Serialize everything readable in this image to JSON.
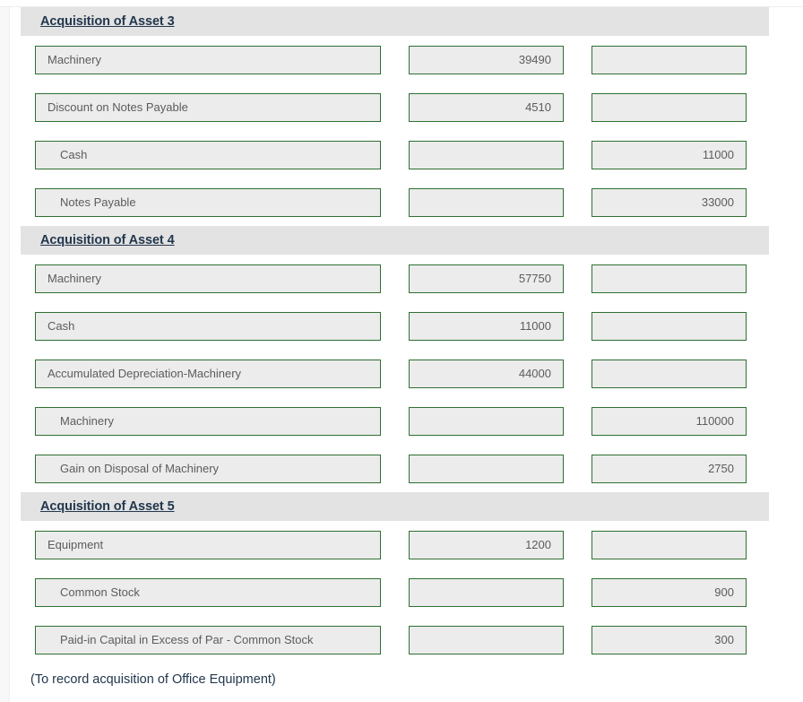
{
  "colors": {
    "field_border": "#2e7031",
    "field_background": "#ececec",
    "header_band": "#e3e3e3",
    "header_text": "#22374e",
    "field_text": "#5c5c5c"
  },
  "sections": [
    {
      "title": "Acquisition of Asset 3",
      "rows": [
        {
          "account": "Machinery",
          "debit": "39490",
          "credit": "",
          "type": "debit"
        },
        {
          "account": "Discount on Notes Payable",
          "debit": "4510",
          "credit": "",
          "type": "debit"
        },
        {
          "account": "Cash",
          "debit": "",
          "credit": "11000",
          "type": "credit"
        },
        {
          "account": "Notes Payable",
          "debit": "",
          "credit": "33000",
          "type": "credit"
        }
      ]
    },
    {
      "title": "Acquisition of Asset 4",
      "rows": [
        {
          "account": "Machinery",
          "debit": "57750",
          "credit": "",
          "type": "debit"
        },
        {
          "account": "Cash",
          "debit": "11000",
          "credit": "",
          "type": "debit"
        },
        {
          "account": "Accumulated Depreciation-Machinery",
          "debit": "44000",
          "credit": "",
          "type": "debit"
        },
        {
          "account": "Machinery",
          "debit": "",
          "credit": "110000",
          "type": "credit"
        },
        {
          "account": "Gain on Disposal of Machinery",
          "debit": "",
          "credit": "2750",
          "type": "credit"
        }
      ]
    },
    {
      "title": "Acquisition of Asset 5",
      "rows": [
        {
          "account": "Equipment",
          "debit": "1200",
          "credit": "",
          "type": "debit"
        },
        {
          "account": "Common Stock",
          "debit": "",
          "credit": "900",
          "type": "credit"
        },
        {
          "account": "Paid-in Capital in Excess of Par - Common Stock",
          "debit": "",
          "credit": "300",
          "type": "credit"
        }
      ]
    }
  ],
  "closing_note": "(To record acquisition of Office Equipment)"
}
